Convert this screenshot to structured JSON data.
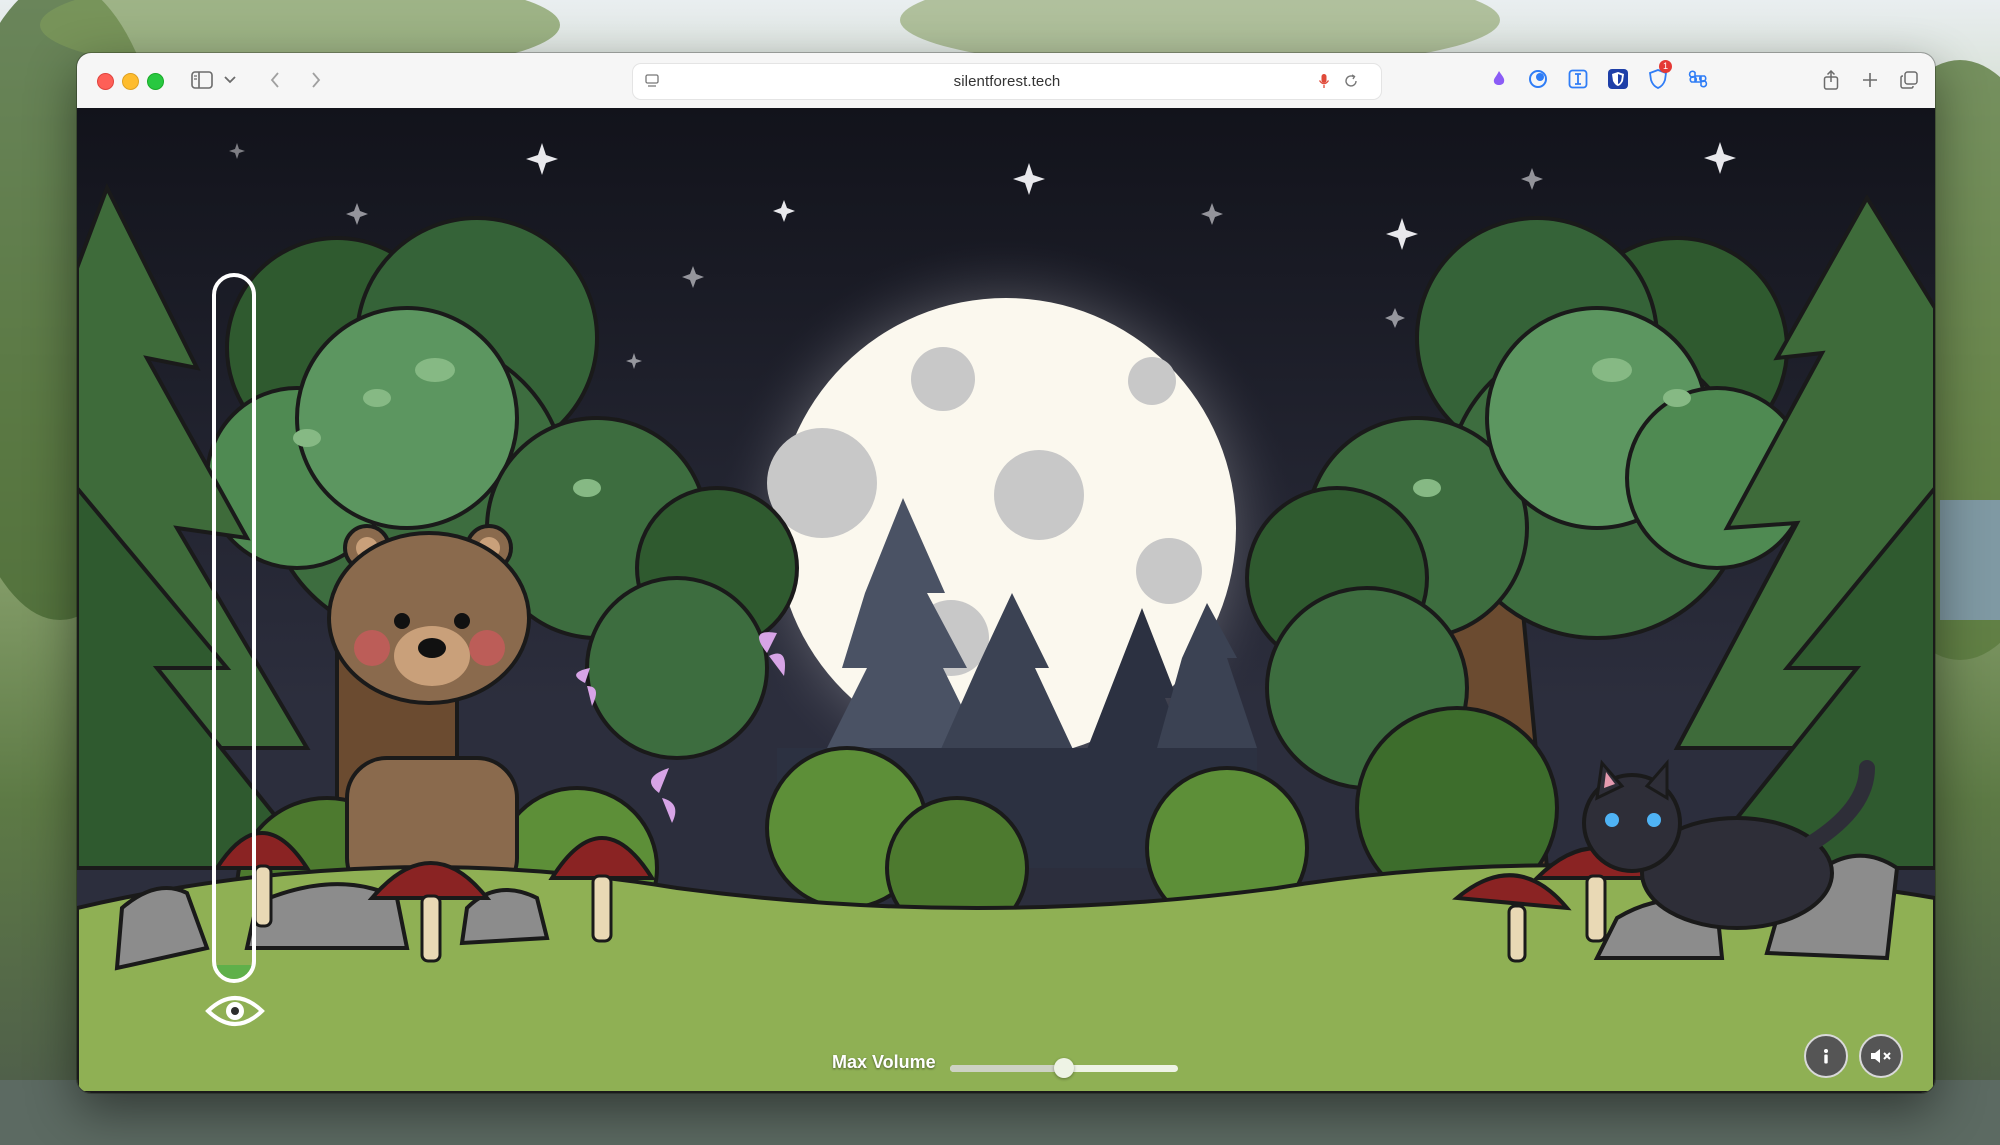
{
  "browser": {
    "url": "silentforest.tech",
    "extension_badge_count": "1",
    "icons": {
      "sidebar": "sidebar-icon",
      "sidebar_menu": "chevron-down-icon",
      "back": "chevron-left-icon",
      "forward": "chevron-right-icon",
      "page_menu": "page-icon",
      "mic": "microphone-icon",
      "reload": "reload-icon",
      "share": "share-icon",
      "new_tab": "plus-icon",
      "tabs_overview": "tabs-icon"
    },
    "extensions": [
      "purple-flame-icon",
      "blue-moon-icon",
      "text-cursor-icon",
      "shield-icon",
      "blue-shield-icon",
      "command-icon"
    ]
  },
  "page": {
    "volume_label": "Max Volume",
    "volume_level": 0.5,
    "noise_meter_level": 0.02,
    "info_button": "info-icon",
    "mute_button": "mute-icon",
    "eye_icon": "eye-icon"
  },
  "colors": {
    "sky_top": "#15161f",
    "moon": "#fbf8ee",
    "moon_crater": "#c8c8c8",
    "meter_fill": "#5fb04a",
    "grass": "#8fb054"
  }
}
